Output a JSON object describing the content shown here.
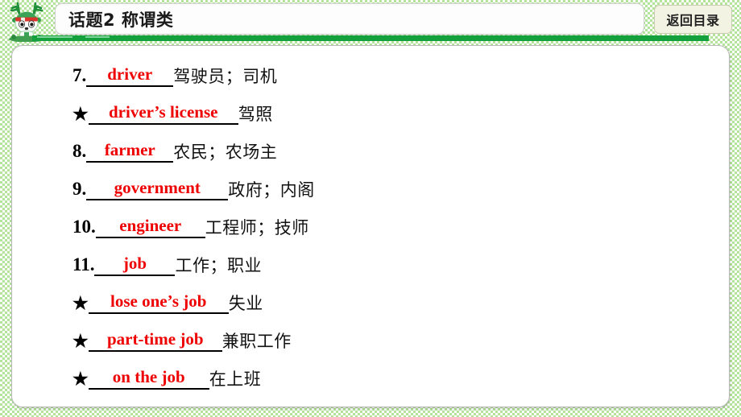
{
  "header": {
    "mascot_icon": "deer-mascot-icon",
    "title": "话题2  称谓类",
    "back_button_label": "返回目录",
    "accent_green": "#14a03c",
    "background_green": "#b4e49b"
  },
  "content": {
    "answer_color": "#ee0000",
    "entries": [
      {
        "marker": "7.",
        "answer": "driver",
        "meaning": "驾驶员；司机"
      },
      {
        "marker": "★",
        "answer": "driver’s license",
        "meaning": "驾照"
      },
      {
        "marker": "8.",
        "answer": "farmer",
        "meaning": "农民；农场主"
      },
      {
        "marker": "9.",
        "answer": "government",
        "meaning": "政府；内阁"
      },
      {
        "marker": "10.",
        "answer": "engineer",
        "meaning": "工程师；技师"
      },
      {
        "marker": "11.",
        "answer": "job",
        "meaning": "工作；职业"
      },
      {
        "marker": "★",
        "answer": "lose one’s job",
        "meaning": "失业"
      },
      {
        "marker": "★",
        "answer": "part-time job",
        "meaning": "兼职工作"
      },
      {
        "marker": "★",
        "answer": "on the job",
        "meaning": "在上班"
      }
    ]
  }
}
